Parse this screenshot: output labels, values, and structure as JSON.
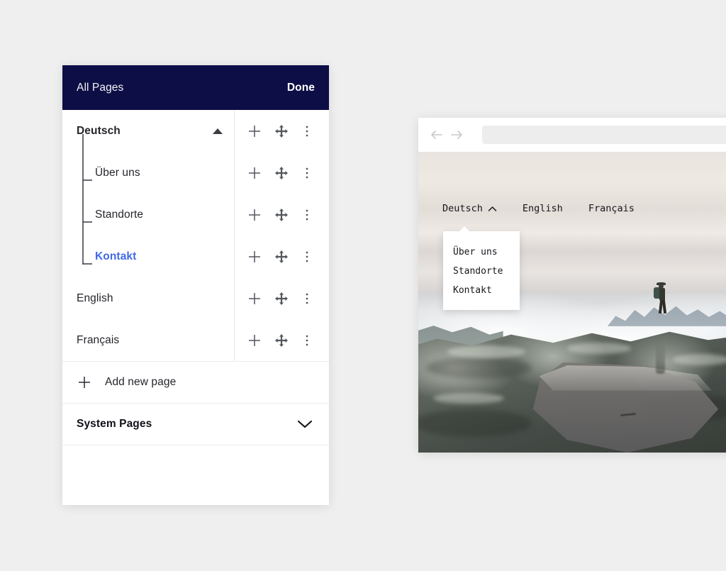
{
  "panel": {
    "header": {
      "title": "All Pages",
      "done_label": "Done"
    },
    "rows": [
      {
        "label": "Deutsch",
        "type": "language",
        "state": "expanded",
        "active": false
      },
      {
        "label": "Über uns",
        "type": "child",
        "active": false
      },
      {
        "label": "Standorte",
        "type": "child",
        "active": false
      },
      {
        "label": "Kontakt",
        "type": "child",
        "active": true
      },
      {
        "label": "English",
        "type": "language",
        "active": false
      },
      {
        "label": "Français",
        "type": "language",
        "active": false
      }
    ],
    "row_icons": [
      "plus-icon",
      "move-icon",
      "more-vertical-icon"
    ],
    "add_new": {
      "label": "Add new page",
      "icon": "plus-icon"
    },
    "system_pages": {
      "label": "System Pages",
      "icon": "chevron-down-icon",
      "state": "collapsed"
    }
  },
  "preview": {
    "browser": {
      "back_icon": "arrow-left-icon",
      "forward_icon": "arrow-right-icon",
      "url_value": "",
      "url_placeholder": ""
    },
    "site_nav": [
      {
        "label": "Deutsch",
        "has_chevron": true,
        "chevron": "chevron-up-icon"
      },
      {
        "label": "English",
        "has_chevron": false
      },
      {
        "label": "Français",
        "has_chevron": false
      }
    ],
    "dropdown": {
      "open_for": "Deutsch",
      "items": [
        "Über uns",
        "Standorte",
        "Kontakt"
      ]
    },
    "photo_alt": "Hiker with backpack standing on rocky summit above clouds, reflected in still pool"
  },
  "colors": {
    "header_navy": "#0d0e46",
    "accent_blue": "#4169e8",
    "page_background": "#efefef",
    "panel_white": "#ffffff",
    "text_dark": "#24252b",
    "divider": "#ececed"
  }
}
